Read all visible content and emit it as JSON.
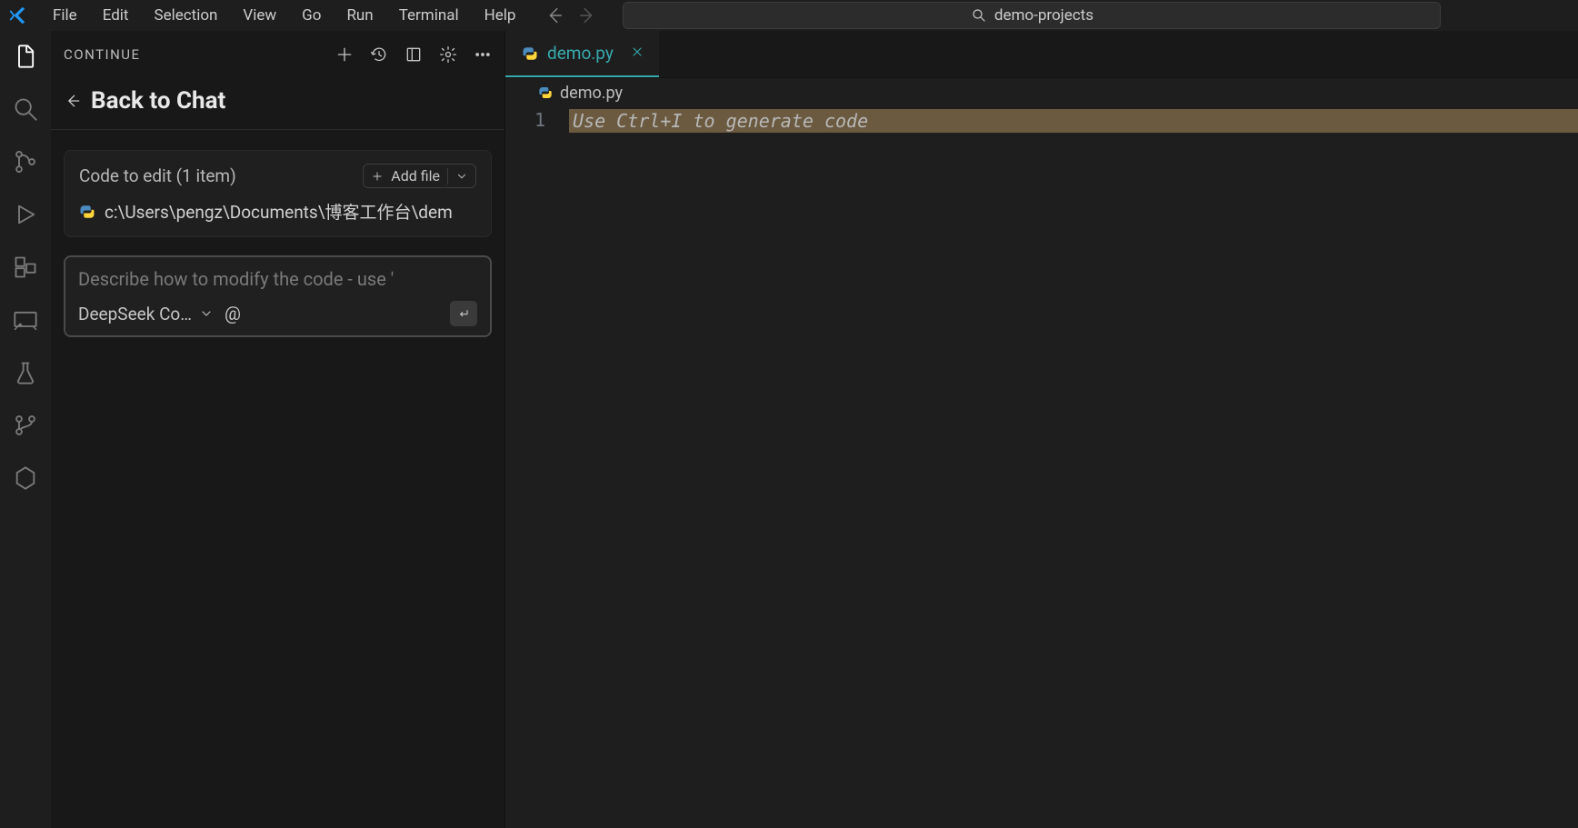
{
  "menubar": {
    "items": [
      "File",
      "Edit",
      "Selection",
      "View",
      "Go",
      "Run",
      "Terminal",
      "Help"
    ]
  },
  "search": {
    "placeholder": "demo-projects"
  },
  "sidebar": {
    "title": "CONTINUE",
    "back_label": "Back to Chat",
    "code_card": {
      "title": "Code to edit (1 item)",
      "add_file_label": "Add file",
      "file_path": "c:\\Users\\pengz\\Documents\\博客工作台\\dem"
    },
    "prompt": {
      "placeholder": "Describe how to modify the code - use '",
      "model": "DeepSeek Co…",
      "at_label": "@"
    }
  },
  "editor": {
    "tab": {
      "label": "demo.py"
    },
    "breadcrumb": "demo.py",
    "line_number": "1",
    "ghost_text": "Use Ctrl+I to generate code"
  }
}
